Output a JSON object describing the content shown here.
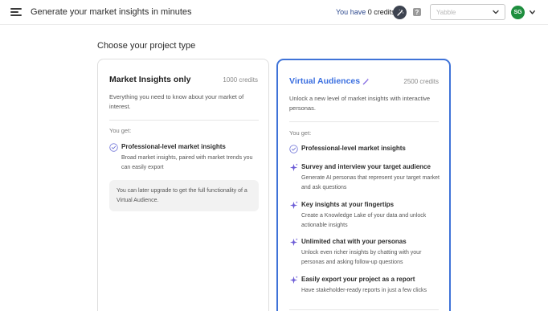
{
  "header": {
    "title": "Generate your market insights in minutes",
    "credits_prefix": "You have",
    "credits_value": "0 credits",
    "help_label": "?",
    "org_select_value": "Yabble",
    "avatar_initials": "SG"
  },
  "main": {
    "section_title": "Choose your project type"
  },
  "cards": {
    "market_insights": {
      "title": "Market Insights only",
      "credits": "1000 credits",
      "description": "Everything you need to know about your market of interest.",
      "you_get": "You get:",
      "features": [
        {
          "title": "Professional-level market insights",
          "description": "Broad market insights, paired with market trends you can easily export",
          "icon": "check-circle-icon"
        }
      ],
      "note": "You can later upgrade to get the full functionality of a Virtual Audience."
    },
    "virtual_audiences": {
      "title": "Virtual Audiences",
      "credits": "2500 credits",
      "description": "Unlock a new level of market insights with interactive personas.",
      "you_get": "You get:",
      "features": [
        {
          "title": "Professional-level market insights",
          "description": "",
          "icon": "check-circle-icon"
        },
        {
          "title": "Survey and interview your target audience",
          "description": "Generate AI personas that represent your target market and ask questions",
          "icon": "sparkle-icon"
        },
        {
          "title": "Key insights at your fingertips",
          "description": "Create a Knowledge Lake of your data and unlock actionable insights",
          "icon": "sparkle-icon"
        },
        {
          "title": "Unlimited chat with your personas",
          "description": "Unlock even richer insights by chatting with your personas and asking follow-up questions",
          "icon": "sparkle-icon"
        },
        {
          "title": "Easily export your project as a report",
          "description": "Have stakeholder-ready reports in just a few clicks",
          "icon": "sparkle-icon"
        }
      ]
    }
  },
  "colors": {
    "accent_blue": "#3f73d8",
    "sparkle_purple": "#6b5bd6",
    "avatar_green": "#1e8e3e",
    "credits_blue": "#2e4a8f"
  }
}
